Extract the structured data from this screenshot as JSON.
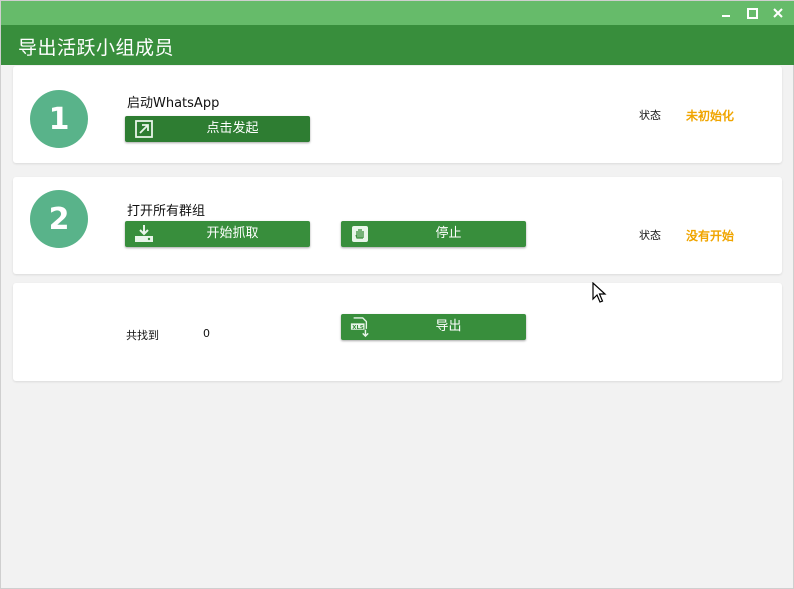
{
  "window": {
    "title": "导出活跃小组成员",
    "controls": [
      "minimize-icon",
      "maximize-icon",
      "close-icon"
    ]
  },
  "colors": {
    "title_bar": "#66bb6a",
    "header": "#388e3c",
    "button": "#388e3c",
    "step_circle": "#59b38a",
    "status_text": "#f0a500"
  },
  "steps": [
    {
      "number": "1",
      "label": "启动WhatsApp",
      "buttons": [
        {
          "label": "点击发起",
          "icon": "external-link-icon"
        }
      ],
      "status_label": "状态",
      "status_value": "未初始化"
    },
    {
      "number": "2",
      "label": "打开所有群组",
      "buttons": [
        {
          "label": "开始抓取",
          "icon": "download-tray-icon"
        },
        {
          "label": "停止",
          "icon": "hand-stop-icon"
        }
      ],
      "status_label": "状态",
      "status_value": "没有开始"
    }
  ],
  "export": {
    "found_label": "共找到",
    "found_count": "0",
    "button_label": "导出",
    "button_icon": "xls-file-icon"
  }
}
